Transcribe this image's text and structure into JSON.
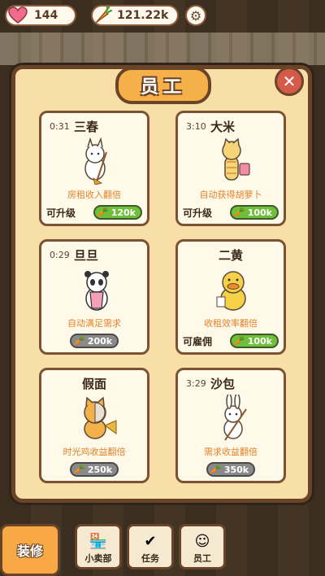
{
  "resources": {
    "hearts": "144",
    "carrots": "121.22k"
  },
  "panel": {
    "title": "员工"
  },
  "staff": [
    {
      "timer": "0:31",
      "name": "三春",
      "desc": "房租收入翻倍",
      "status": "可升级",
      "cost": "120k",
      "cost_style": "green",
      "character": "white-cat-with-broom"
    },
    {
      "timer": "3:10",
      "name": "大米",
      "desc": "自动获得胡萝卜",
      "status": "可升级",
      "cost": "100k",
      "cost_style": "green",
      "character": "yellow-tabby-cat-with-bag"
    },
    {
      "timer": "0:29",
      "name": "旦旦",
      "desc": "自动满足需求",
      "status": "",
      "cost": "200k",
      "cost_style": "gray",
      "character": "panda"
    },
    {
      "timer": "",
      "name": "二黄",
      "desc": "收租效率翻倍",
      "status": "可雇佣",
      "cost": "100k",
      "cost_style": "green",
      "character": "yellow-duck"
    },
    {
      "timer": "",
      "name": "假面",
      "desc": "时光鸡收益翻倍",
      "status": "",
      "cost": "250k",
      "cost_style": "gray",
      "character": "masked-cat-with-trumpet"
    },
    {
      "timer": "3:29",
      "name": "沙包",
      "desc": "需求收益翻倍",
      "status": "",
      "cost": "350k",
      "cost_style": "gray",
      "character": "white-rabbit-with-broom"
    }
  ],
  "nav": {
    "install": "装修",
    "shop": "小卖部",
    "tasks": "任务",
    "staff": "员工"
  },
  "colors": {
    "panel": "#f8dfa8",
    "border": "#6a4428",
    "accent": "#f6b04a",
    "upgrade": "#6fbf3a",
    "desc": "#e2832a"
  }
}
